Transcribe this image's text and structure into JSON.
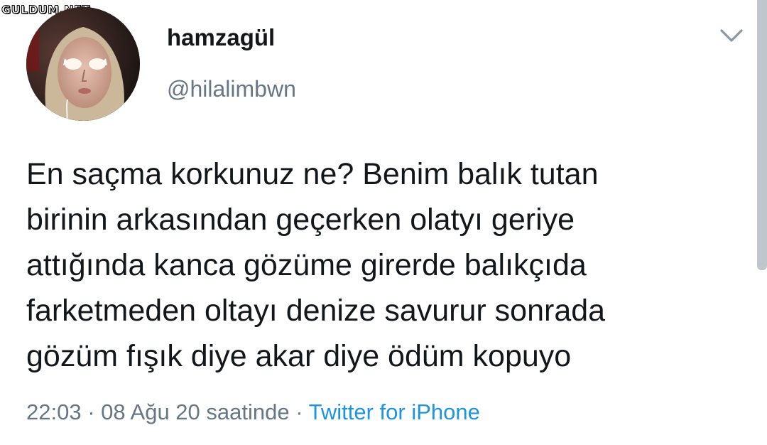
{
  "watermark": "GULDUM.NET",
  "tweet": {
    "author": {
      "display_name": "hamzagül",
      "handle": "@hilalimbwn",
      "avatar_icon": "profile-photo"
    },
    "menu_icon": "chevron-down-icon",
    "text_lines": [
      "En saçma korkunuz ne? Benim balık tutan",
      "birinin arkasından geçerken olatyı geriye",
      "attığında kanca gözüme girerde balıkçıda",
      "farketmeden oltayı denize savurur sonrada",
      "gözüm fışık diye akar diye ödüm kopuyo"
    ],
    "time": "22:03",
    "separator": "·",
    "date": "08 Ağu 20 saatinde",
    "source": "Twitter for iPhone"
  },
  "colors": {
    "text": "#14171a",
    "secondary": "#657786",
    "link": "#1b95e0",
    "background": "#ffffff"
  }
}
